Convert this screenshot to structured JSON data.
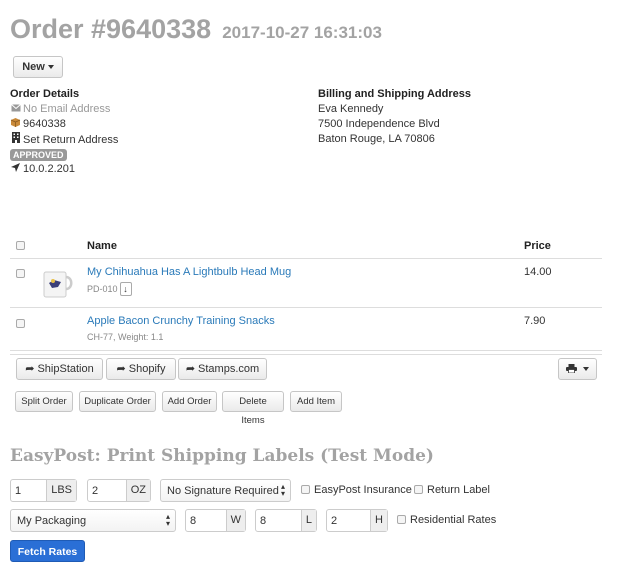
{
  "header": {
    "order_title": "Order #9640338",
    "datetime": "2017-10-27 16:31:03",
    "new_label": "New"
  },
  "order_details": {
    "heading": "Order Details",
    "email": "No Email Address",
    "order_number": "9640338",
    "return_address": "Set Return Address",
    "status": "APPROVED",
    "ip": "10.0.2.201"
  },
  "address": {
    "heading": "Billing and Shipping Address",
    "name": "Eva Kennedy",
    "street": "7500 Independence Blvd",
    "city_state_zip": "Baton Rouge, LA 70806"
  },
  "items_table": {
    "columns": [
      "Name",
      "Price"
    ],
    "rows": [
      {
        "name": "My Chihuahua Has A Lightbulb Head Mug",
        "sku": "PD-010",
        "price": "14.00",
        "has_image": true
      },
      {
        "name": "Apple Bacon Crunchy Training Snacks",
        "sku": "CH-77, Weight: 1.1",
        "price": "7.90",
        "has_image": false
      }
    ]
  },
  "ship_buttons": [
    "ShipStation",
    "Shopify",
    "Stamps.com"
  ],
  "actions": [
    "Split Order",
    "Duplicate Order",
    "Add Order",
    "Delete Items",
    "Add Item"
  ],
  "easypost": {
    "title": "EasyPost: Print Shipping Labels (Test Mode)",
    "weight_lbs": "1",
    "lbs_unit": "LBS",
    "weight_oz": "2",
    "oz_unit": "OZ",
    "signature_option": "No Signature Required",
    "insurance_label": "EasyPost Insurance",
    "return_label": "Return Label",
    "packaging": "My Packaging",
    "width": "8",
    "width_unit": "W",
    "length": "8",
    "length_unit": "L",
    "height": "2",
    "height_unit": "H",
    "residential_label": "Residential Rates",
    "fetch_label": "Fetch Rates"
  },
  "colors": {
    "link": "#2a7ab9",
    "primary": "#2a6fd6",
    "heading_gray": "#a3a3a3",
    "badge": "#999999"
  }
}
